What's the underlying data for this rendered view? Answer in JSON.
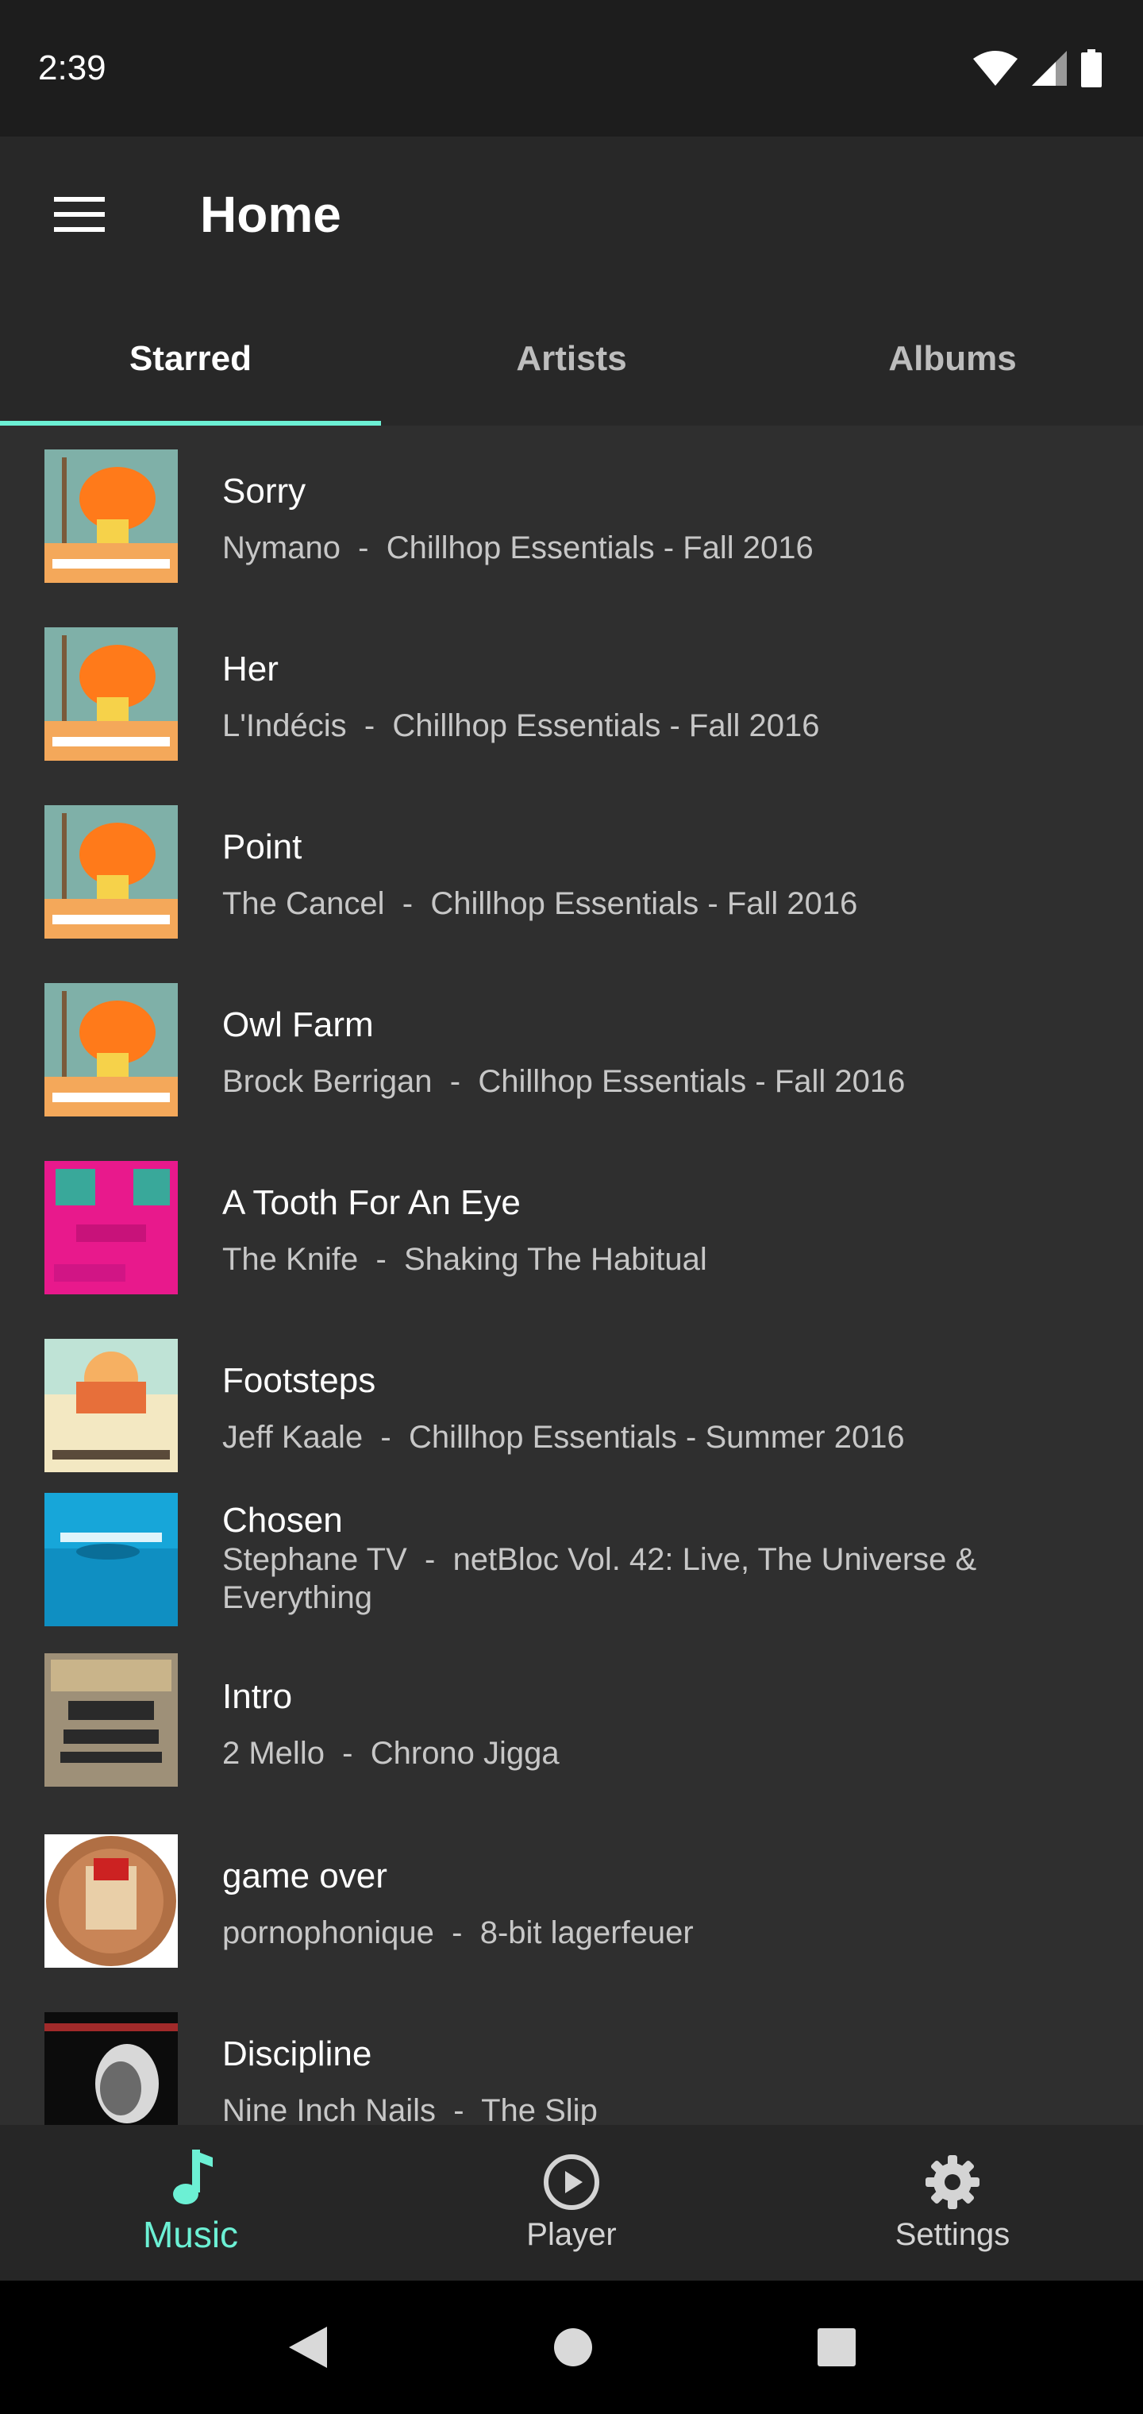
{
  "status_bar": {
    "time": "2:39"
  },
  "app_bar": {
    "title": "Home"
  },
  "tabs": [
    {
      "label": "Starred",
      "active": true
    },
    {
      "label": "Artists",
      "active": false
    },
    {
      "label": "Albums",
      "active": false
    }
  ],
  "songs": [
    {
      "title": "Sorry",
      "artist": "Nymano",
      "album": "Chillhop Essentials - Fall 2016",
      "art": "chillhop-fall"
    },
    {
      "title": "Her",
      "artist": "L'Indécis",
      "album": "Chillhop Essentials - Fall 2016",
      "art": "chillhop-fall"
    },
    {
      "title": "Point",
      "artist": "The Cancel",
      "album": "Chillhop Essentials - Fall 2016",
      "art": "chillhop-fall"
    },
    {
      "title": "Owl Farm",
      "artist": "Brock Berrigan",
      "album": "Chillhop Essentials - Fall 2016",
      "art": "chillhop-fall"
    },
    {
      "title": "A Tooth For An Eye",
      "artist": "The Knife",
      "album": "Shaking The Habitual",
      "art": "the-knife"
    },
    {
      "title": "Footsteps",
      "artist": "Jeff Kaale",
      "album": "Chillhop Essentials - Summer 2016",
      "art": "chillhop-summer"
    },
    {
      "title": "Chosen",
      "artist": "Stephane TV",
      "album": "netBloc Vol. 42: Live, The Universe & Everything",
      "art": "netbloc"
    },
    {
      "title": "Intro",
      "artist": "2 Mello",
      "album": "Chrono Jigga",
      "art": "chrono-jigga"
    },
    {
      "title": "game over",
      "artist": "pornophonique",
      "album": "8-bit lagerfeuer",
      "art": "8bit"
    },
    {
      "title": "Discipline",
      "artist": "Nine Inch Nails",
      "album": "The Slip",
      "art": "the-slip"
    }
  ],
  "separator": "  -  ",
  "bottom_nav": [
    {
      "label": "Music",
      "icon": "music-note-icon",
      "active": true
    },
    {
      "label": "Player",
      "icon": "play-circle-icon",
      "active": false
    },
    {
      "label": "Settings",
      "icon": "gear-icon",
      "active": false
    }
  ],
  "colors": {
    "accent": "#6cf0d4",
    "background": "#2f2f2f",
    "bar": "#282828"
  }
}
